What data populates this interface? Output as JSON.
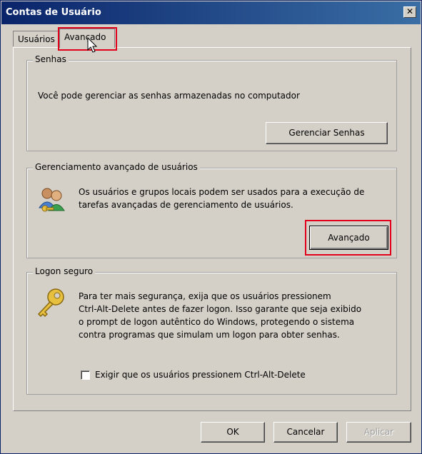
{
  "window": {
    "title": "Contas de Usuário",
    "close_label": "✕"
  },
  "tabs": [
    {
      "label": "Usuários",
      "selected": false
    },
    {
      "label": "Avançado",
      "selected": true
    }
  ],
  "senhas": {
    "title": "Senhas",
    "description": "Você pode gerenciar as senhas armazenadas no computador",
    "button_label": "Gerenciar Senhas"
  },
  "gerenciamento": {
    "title": "Gerenciamento avançado de usuários",
    "description_line1": "Os usuários e grupos locais podem ser usados para a execução de",
    "description_line2": "tarefas avançadas de gerenciamento de usuários.",
    "button_label": "Avançado",
    "icon": "users-icon"
  },
  "logon": {
    "title": "Logon seguro",
    "description_line1": "Para ter mais segurança, exija que os usuários pressionem",
    "description_line2": "Ctrl-Alt-Delete antes de fazer logon. Isso garante que seja exibido",
    "description_line3": "o prompt de logon autêntico do Windows, protegendo o sistema",
    "description_line4": "contra programas que simulam um logon para obter senhas.",
    "checkbox_label": "Exigir que os usuários pressionem Ctrl-Alt-Delete",
    "checkbox_checked": false,
    "icon": "key-icon"
  },
  "footer": {
    "ok_label": "OK",
    "cancel_label": "Cancelar",
    "apply_label": "Aplicar",
    "apply_enabled": false
  },
  "highlight_color": "#e0001b"
}
